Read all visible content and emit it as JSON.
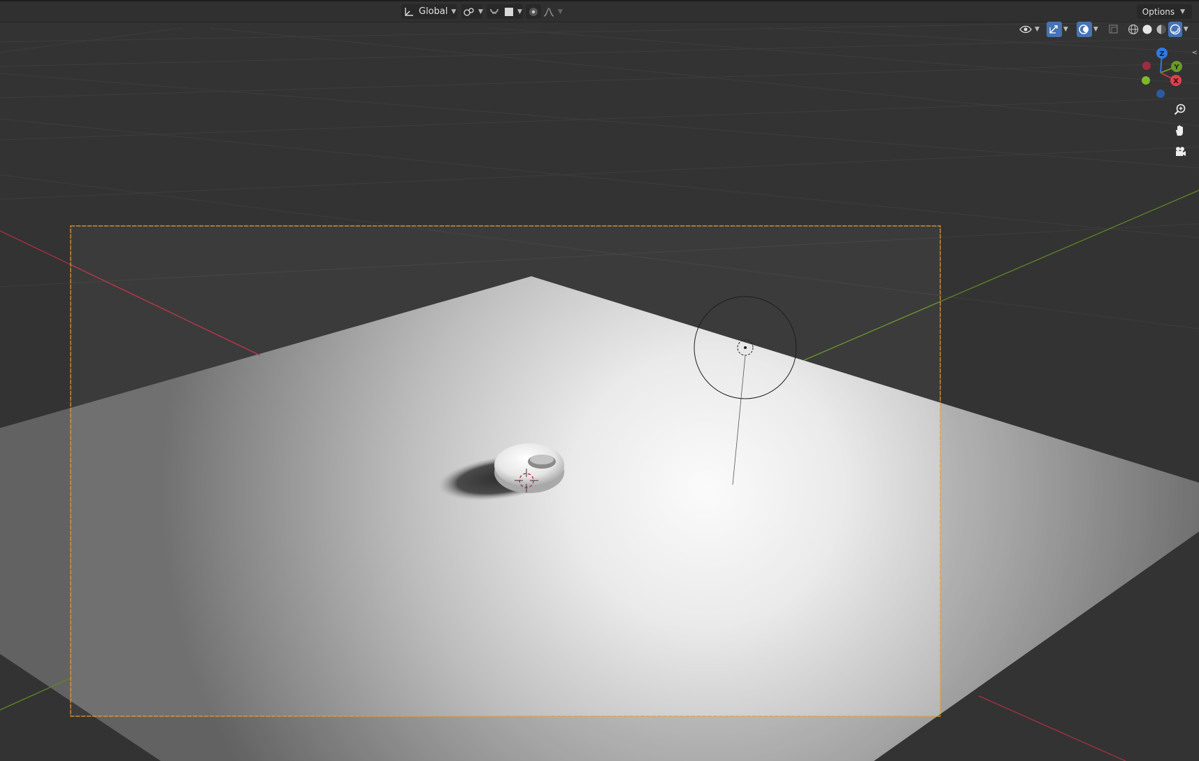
{
  "header": {
    "transform_orientation": "Global",
    "options_label": "Options"
  },
  "gizmo": {
    "z_label": "Z",
    "y_label": "Y",
    "x_label": "X"
  },
  "icons": {
    "orientation": "transform-orientation-icon",
    "pivot": "pivot-point-icon",
    "snap": "snap-magnet-icon",
    "snap_target": "snap-target-icon",
    "proportional": "proportional-edit-icon",
    "falloff": "falloff-curve-icon",
    "visibility": "object-visibility-icon",
    "gizmo_toggle": "gizmo-toggle-icon",
    "overlays": "overlays-icon",
    "xray": "xray-icon",
    "wireframe": "wireframe-shading-icon",
    "solid": "solid-shading-icon",
    "material": "material-preview-icon",
    "rendered": "rendered-shading-icon",
    "zoom": "zoom-icon",
    "pan": "pan-hand-icon",
    "camera": "camera-view-icon"
  },
  "colors": {
    "x_axis": "#c0374a",
    "y_axis": "#6a9a2a",
    "z_axis": "#2f7be0",
    "camera_frame": "#e8a033",
    "active_button": "#4772b3"
  }
}
